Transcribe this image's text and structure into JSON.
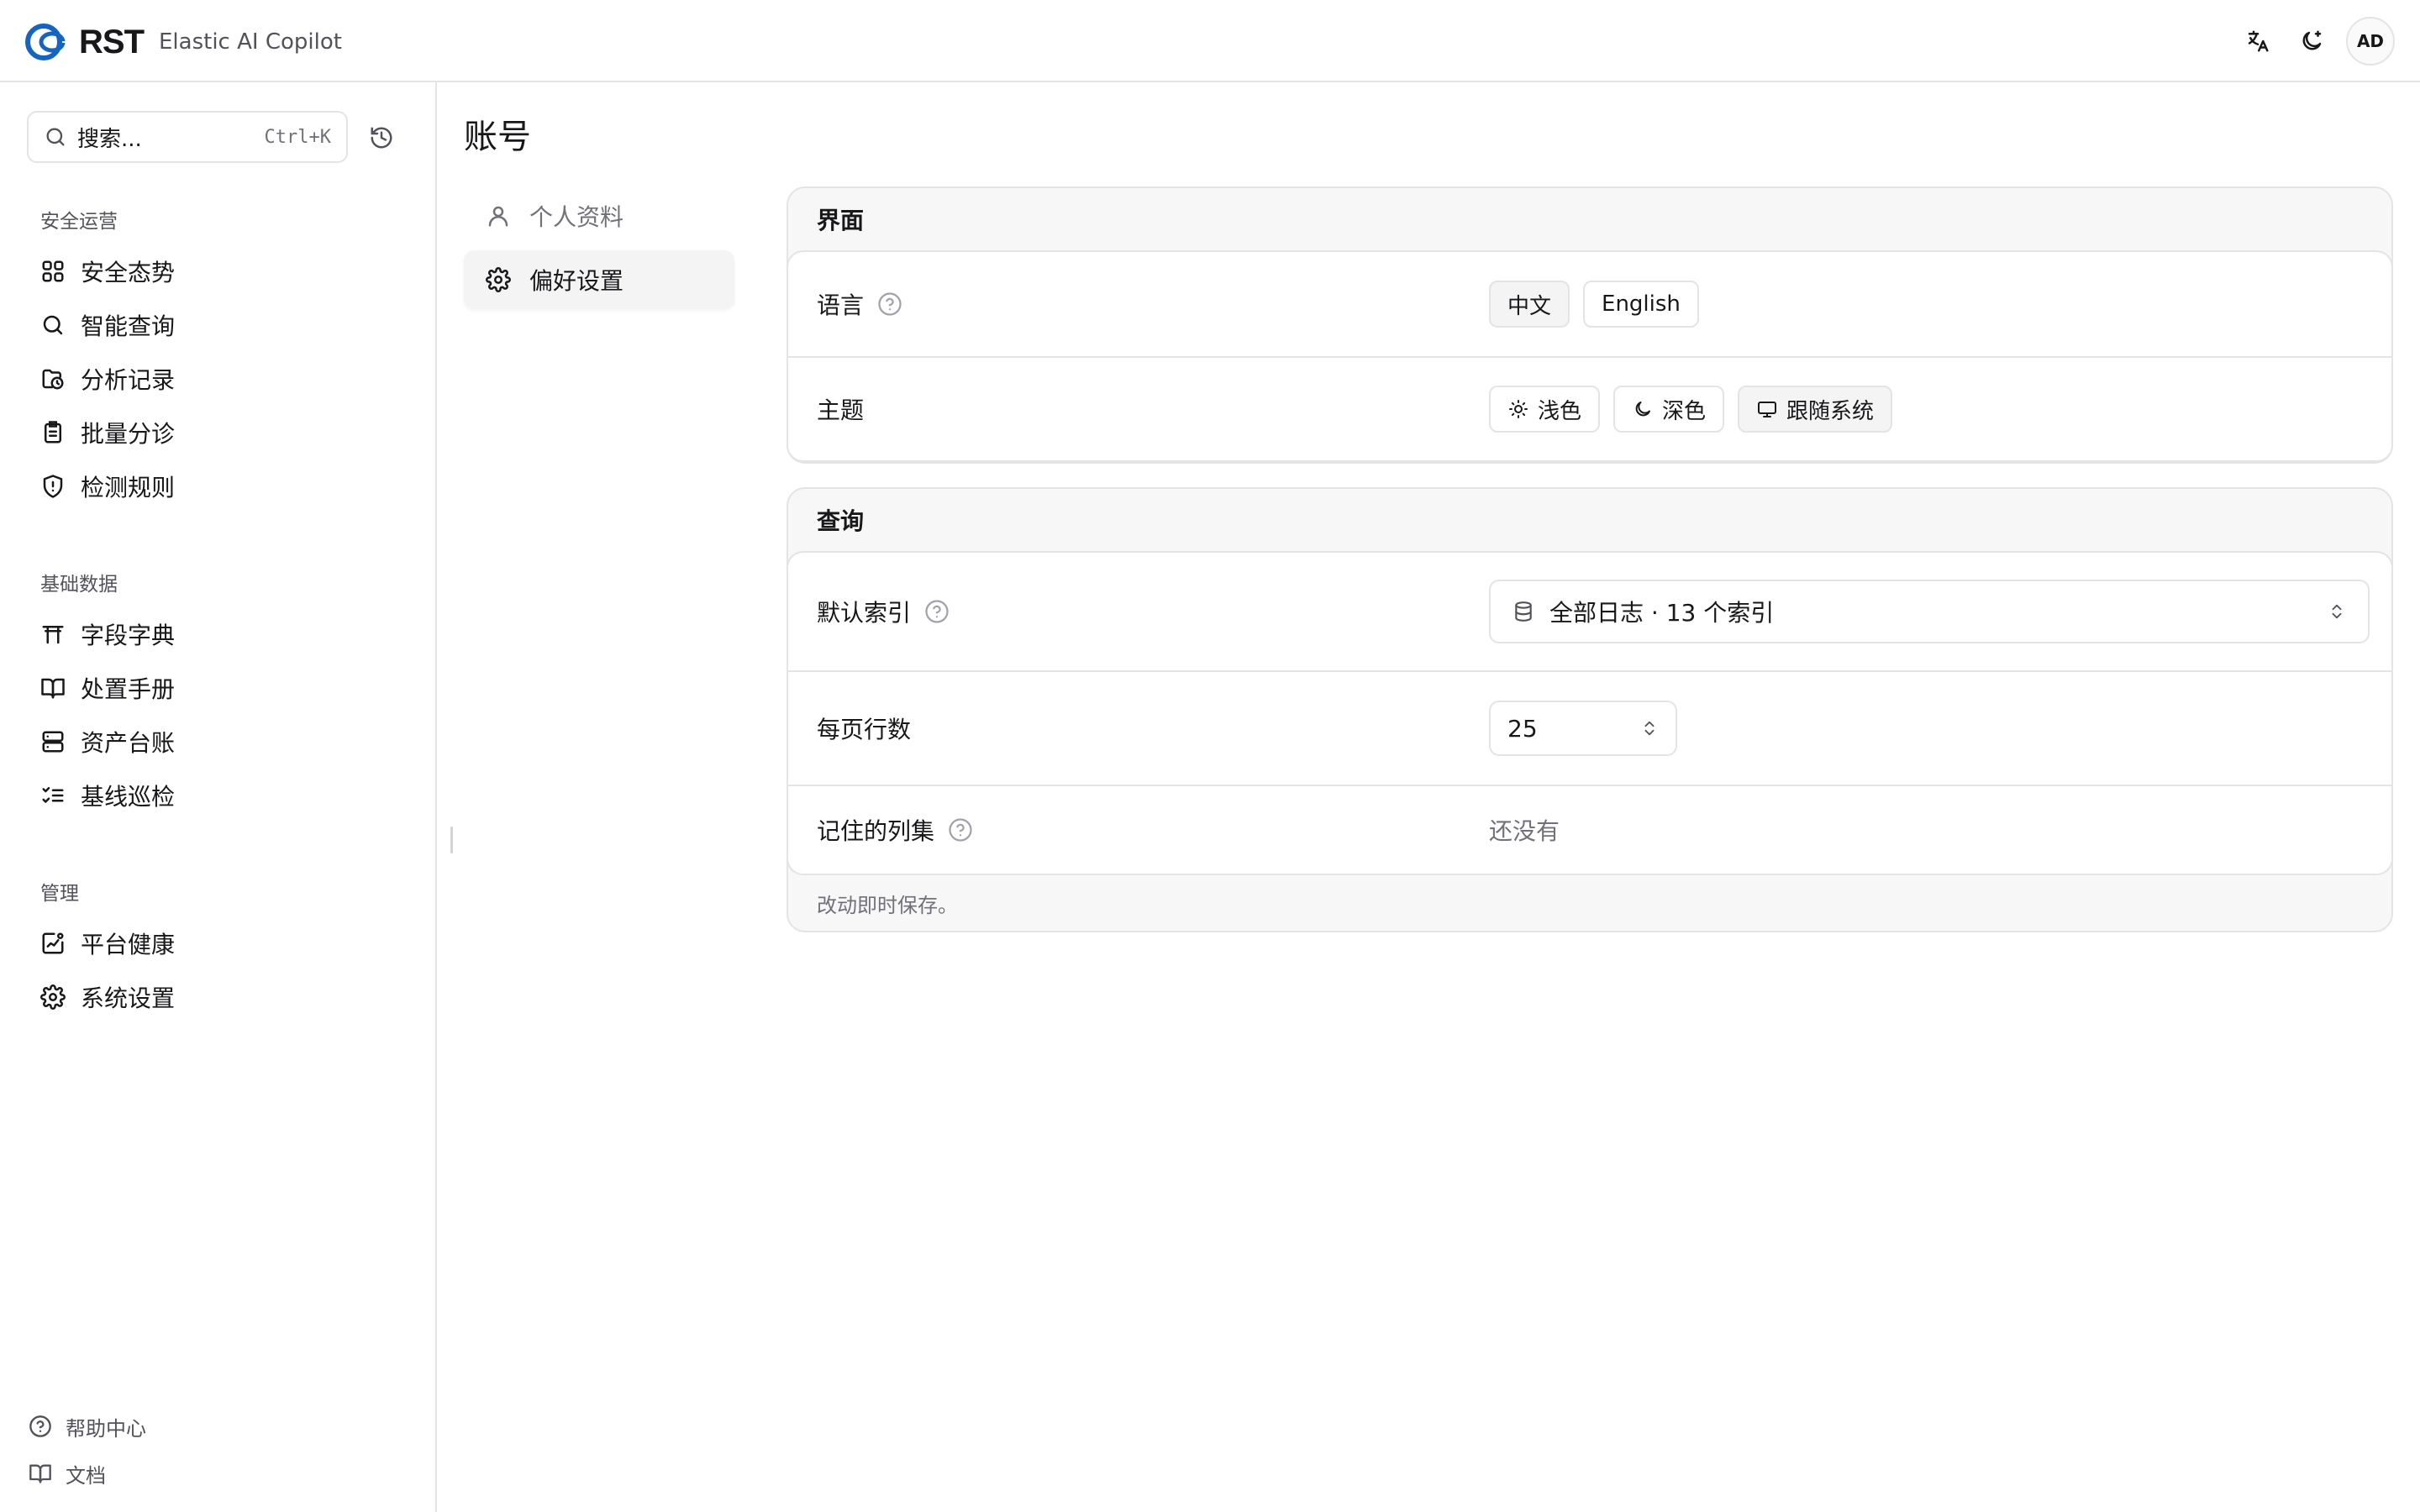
{
  "header": {
    "brand": "RST",
    "product": "Elastic AI Copilot",
    "icons": [
      "translate-icon",
      "theme-toggle-icon"
    ],
    "avatar_initials": "AD"
  },
  "sidebar": {
    "search": {
      "placeholder": "搜索...",
      "shortcut": "Ctrl+K"
    },
    "groups": [
      {
        "label": "安全运营",
        "items": [
          {
            "label": "安全态势",
            "icon": "grid-icon"
          },
          {
            "label": "智能查询",
            "icon": "search-icon"
          },
          {
            "label": "分析记录",
            "icon": "clock-folder-icon"
          },
          {
            "label": "批量分诊",
            "icon": "clipboard-icon"
          },
          {
            "label": "检测规则",
            "icon": "shield-alert-icon"
          }
        ]
      },
      {
        "label": "基础数据",
        "items": [
          {
            "label": "字段字典",
            "icon": "torii-icon"
          },
          {
            "label": "处置手册",
            "icon": "book-open-icon"
          },
          {
            "label": "资产台账",
            "icon": "server-icon"
          },
          {
            "label": "基线巡检",
            "icon": "list-checks-icon"
          }
        ]
      },
      {
        "label": "管理",
        "items": [
          {
            "label": "平台健康",
            "icon": "activity-square-icon"
          },
          {
            "label": "系统设置",
            "icon": "gear-icon"
          }
        ]
      }
    ],
    "footer": [
      {
        "label": "帮助中心",
        "icon": "help-circle-icon"
      },
      {
        "label": "文档",
        "icon": "book-icon"
      }
    ]
  },
  "page": {
    "title": "账号",
    "subnav": [
      {
        "label": "个人资料",
        "icon": "user-icon",
        "active": false
      },
      {
        "label": "偏好设置",
        "icon": "gear-icon",
        "active": true
      }
    ]
  },
  "interface_card": {
    "title": "界面",
    "language": {
      "label": "语言",
      "options": [
        {
          "label": "中文",
          "selected": true
        },
        {
          "label": "English",
          "selected": false
        }
      ]
    },
    "theme": {
      "label": "主题",
      "options": [
        {
          "label": "浅色",
          "icon": "sun-icon",
          "selected": false
        },
        {
          "label": "深色",
          "icon": "moon-icon",
          "selected": false
        },
        {
          "label": "跟随系统",
          "icon": "monitor-icon",
          "selected": true
        }
      ]
    }
  },
  "query_card": {
    "title": "查询",
    "default_index": {
      "label": "默认索引",
      "value": "全部日志 · 13 个索引"
    },
    "rows_per_page": {
      "label": "每页行数",
      "value": "25"
    },
    "remembered_columns": {
      "label": "记住的列集",
      "value": "还没有"
    },
    "footnote": "改动即时保存。"
  },
  "colors": {
    "brand_blue": "#1565c0",
    "border": "#e4e4e7",
    "card_bg": "#f7f7f7",
    "selected_bg": "#f4f4f5",
    "muted_text": "#71717a"
  }
}
